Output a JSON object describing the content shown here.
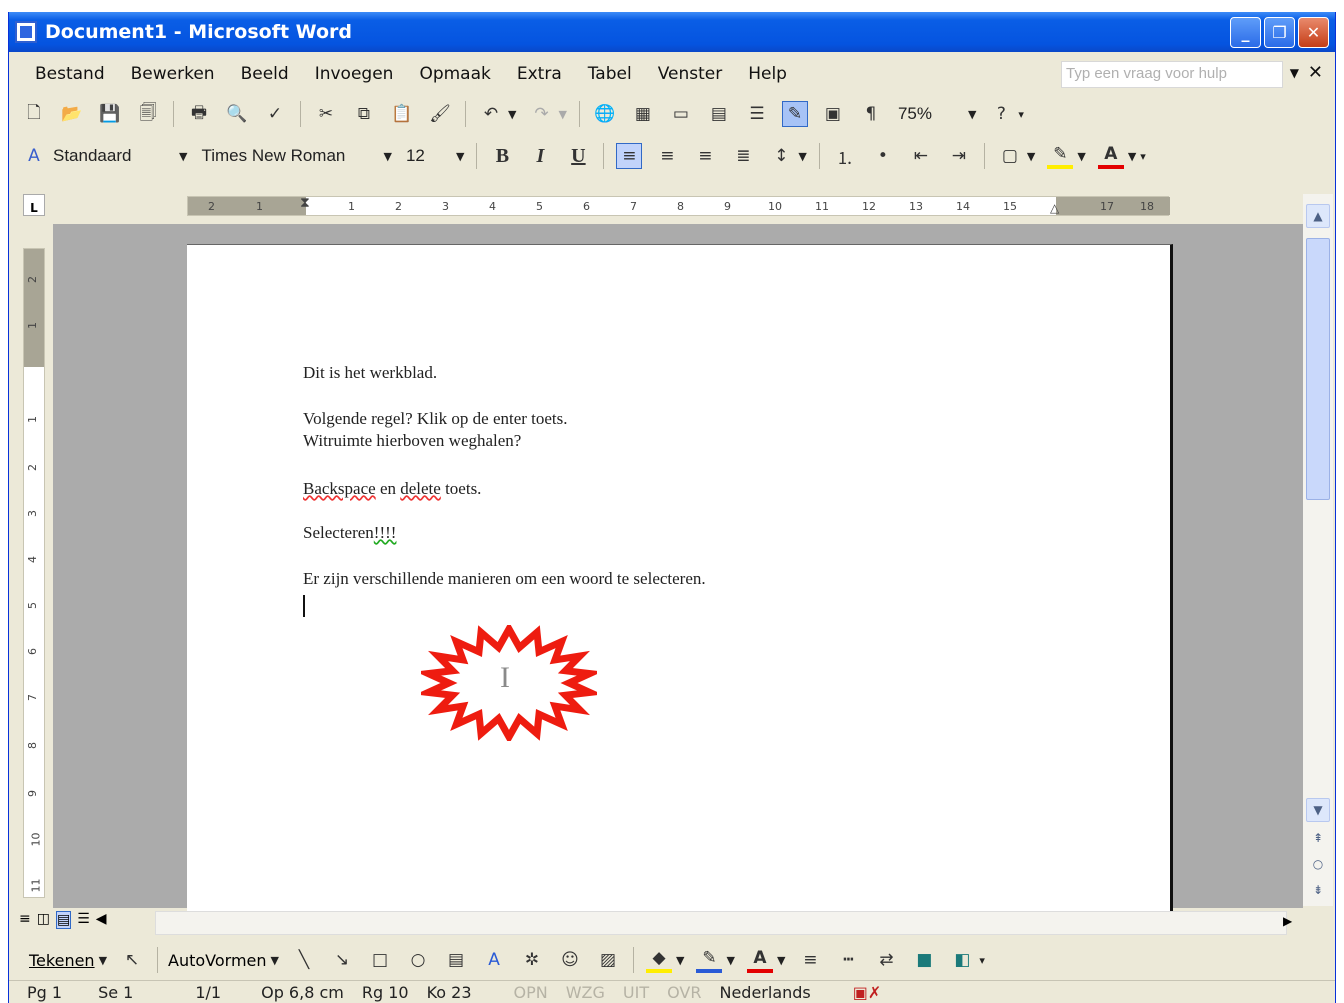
{
  "window": {
    "title": "Document1 - Microsoft Word"
  },
  "menu": [
    "Bestand",
    "Bewerken",
    "Beeld",
    "Invoegen",
    "Opmaak",
    "Extra",
    "Tabel",
    "Venster",
    "Help"
  ],
  "help_placeholder": "Typ een vraag voor hulp",
  "toolbar": {
    "zoom": "75%"
  },
  "format": {
    "style": "Standaard",
    "font": "Times New Roman",
    "size": "12",
    "bold": "B",
    "italic": "I",
    "underline": "U"
  },
  "ruler": {
    "h_ticks": [
      "2",
      "1",
      "1",
      "2",
      "3",
      "4",
      "5",
      "6",
      "7",
      "8",
      "9",
      "10",
      "11",
      "12",
      "13",
      "14",
      "15",
      "17",
      "18"
    ],
    "v_ticks": [
      "2",
      "1",
      "1",
      "2",
      "3",
      "4",
      "5",
      "6",
      "7",
      "8",
      "9",
      "10",
      "11"
    ]
  },
  "document": {
    "line1": "Dit is het werkblad.",
    "line2": "Volgende regel? Klik op de enter toets.",
    "line3": "Witruimte hierboven weghalen?",
    "line4_err1": "Backspace",
    "line4_mid": " en ",
    "line4_err2": "delete",
    "line4_end": " toets.",
    "line5_a": "Selecteren",
    "line5_b": "!!!!",
    "line6": "Er zijn verschillende manieren om een woord te selecteren."
  },
  "drawing": {
    "tekenen": "Tekenen",
    "autovormen": "AutoVormen"
  },
  "status": {
    "pg": "Pg 1",
    "se": "Se 1",
    "pages": "1/1",
    "op": "Op 6,8 cm",
    "rg": "Rg 10",
    "ko": "Ko 23",
    "opn": "OPN",
    "wzg": "WZG",
    "uit": "UIT",
    "ovr": "OVR",
    "lang": "Nederlands"
  },
  "colors": {
    "titlebar": "#0554e0",
    "burst": "#ee1c10",
    "chrome": "#ECE9D8"
  }
}
